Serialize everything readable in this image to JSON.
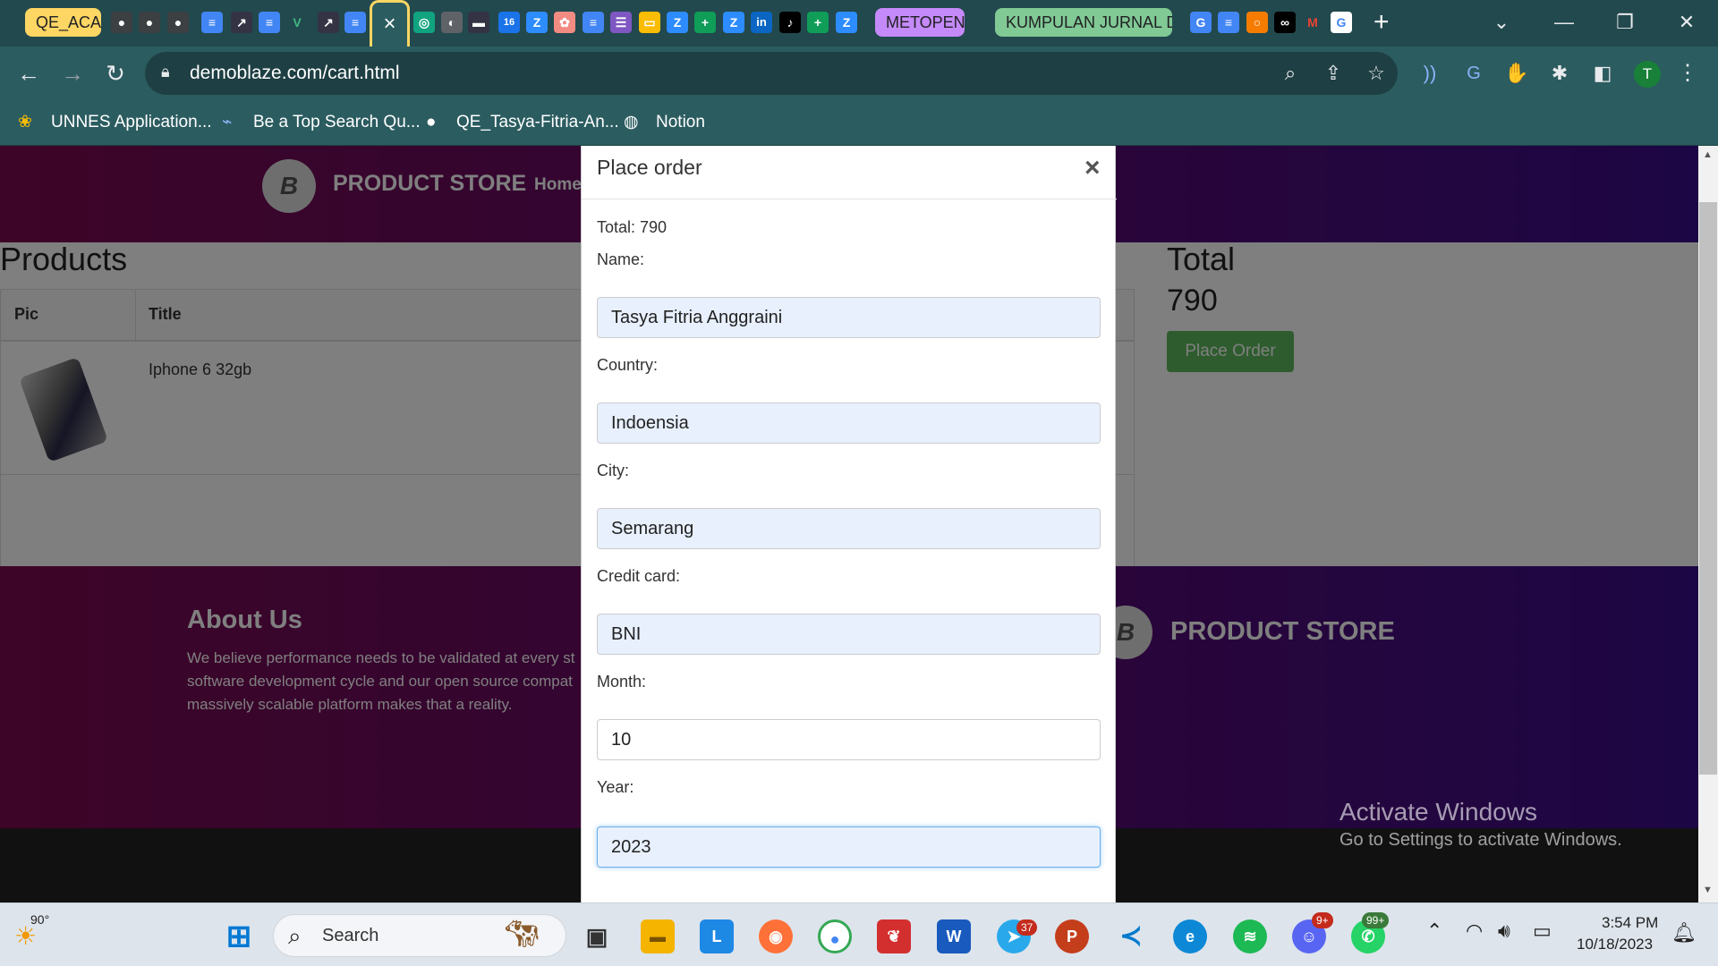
{
  "browser": {
    "tab_groups": [
      {
        "label": "QE_ACA"
      },
      {
        "label": "METOPEN"
      },
      {
        "label": "KUMPULAN JURNAL D"
      }
    ],
    "active_tab_close": "×",
    "new_tab": "+",
    "url": "demoblaze.com/cart.html",
    "profile_initial": "T",
    "bookmarks": [
      {
        "label": "UNNES Application..."
      },
      {
        "label": "Be a Top Search Qu..."
      },
      {
        "label": "QE_Tasya-Fitria-An..."
      },
      {
        "label": "Notion"
      }
    ]
  },
  "site": {
    "brand": "PRODUCT STORE",
    "nav_home": "Home",
    "products_heading": "Products",
    "table_headers": [
      "Pic",
      "Title"
    ],
    "cart_rows": [
      {
        "title": "Iphone 6 32gb"
      }
    ],
    "total_heading": "Total",
    "total_value": "790",
    "place_order_button": "Place Order",
    "about_heading": "About Us",
    "about_text_lines": [
      "We believe performance needs to be validated at every st",
      "software development cycle and our open source compat",
      "massively scalable platform makes that a reality."
    ],
    "footer_brand": "PRODUCT STORE"
  },
  "modal": {
    "title": "Place order",
    "close": "×",
    "total": "Total: 790",
    "fields": {
      "name": {
        "label": "Name:",
        "value": "Tasya Fitria Anggraini"
      },
      "country": {
        "label": "Country:",
        "value": "Indoensia"
      },
      "city": {
        "label": "City:",
        "value": "Semarang"
      },
      "card": {
        "label": "Credit card:",
        "value": "BNI"
      },
      "month": {
        "label": "Month:",
        "value": "10"
      },
      "year": {
        "label": "Year:",
        "value": "2023"
      }
    }
  },
  "watermark": {
    "title": "Activate Windows",
    "subtitle": "Go to Settings to activate Windows."
  },
  "taskbar": {
    "weather": "90°",
    "search_placeholder": "Search",
    "time": "3:54 PM",
    "date": "10/18/2023",
    "badges": {
      "telegram": "37",
      "discord": "9+",
      "whatsapp": "99+"
    }
  },
  "colors": {
    "navbar_start": "#7b0a4f",
    "navbar_end": "#3a0d8a",
    "success_button": "#5cb85c",
    "chrome_tab_bg": "#22494e",
    "chrome_toolbar": "#2b5c60"
  }
}
